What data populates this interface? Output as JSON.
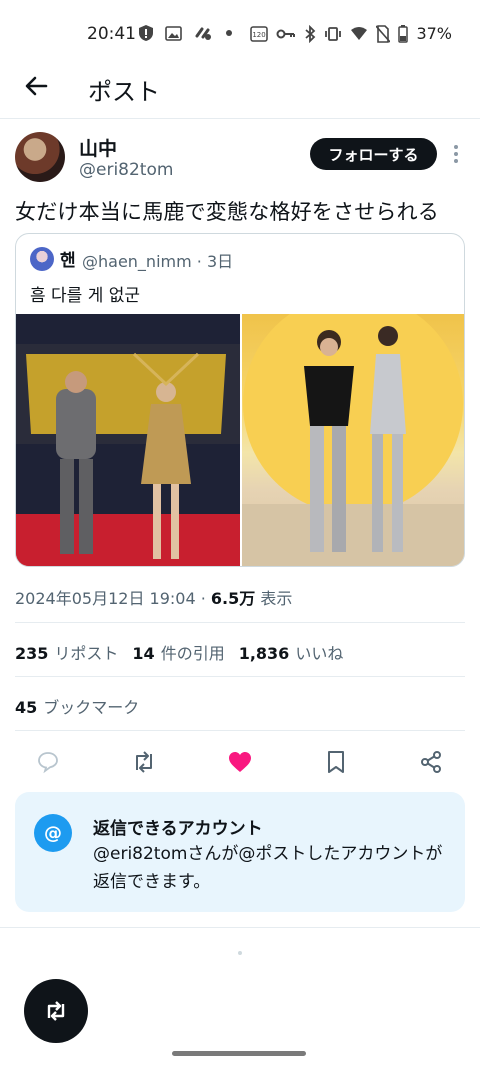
{
  "status_bar": {
    "time": "20:41",
    "battery": "37%",
    "icons": [
      "shield-alert-icon",
      "image-icon",
      "link-icon",
      "dot-icon",
      "hd-icon",
      "vpn-key-icon",
      "bluetooth-icon",
      "vibrate-icon",
      "wifi-icon",
      "no-sim-icon",
      "battery-icon"
    ]
  },
  "header": {
    "title": "ポスト",
    "back_icon": "arrow-left-icon"
  },
  "post": {
    "author_name": "山中",
    "author_handle": "@eri82tom",
    "follow_label": "フォローする",
    "text": "女だけ本当に馬鹿で変態な格好をさせられる",
    "quoted": {
      "author_name": "핸",
      "author_handle": "@haen_nimm · 3日",
      "text": "흠 다를 게 없군",
      "images": [
        "red-carpet-photo",
        "premiere-photo"
      ]
    },
    "timestamp": "2024年05月12日 19:04 · ",
    "views_count": "6.5万",
    "views_label": " 表示",
    "reposts_count": "235",
    "reposts_label": "リポスト",
    "quotes_count": "14",
    "quotes_label": "件の引用",
    "likes_count": "1,836",
    "likes_label": "いいね",
    "bookmarks_count": "45",
    "bookmarks_label": "ブックマーク"
  },
  "actions": [
    "reply-icon",
    "repost-icon",
    "like-icon",
    "bookmark-icon",
    "share-icon"
  ],
  "reply_restriction": {
    "title": "返信できるアカウント",
    "description": "@eri82tomさんが@ポストしたアカウントが返信できます。",
    "icon_text": "@"
  },
  "colors": {
    "accent": "#1d9bf0",
    "like": "#f91880",
    "text": "#0f1419",
    "secondary": "#536471"
  }
}
